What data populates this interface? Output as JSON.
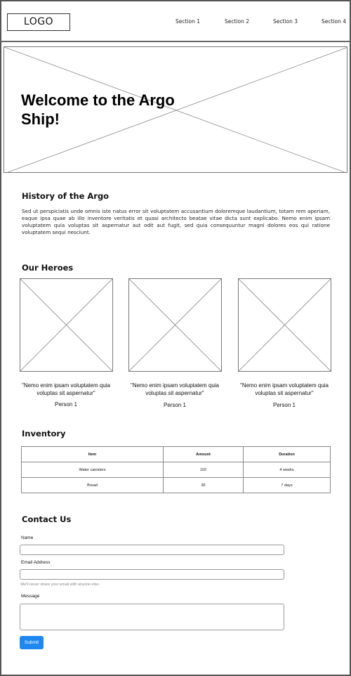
{
  "header": {
    "logo": "LOGO",
    "nav": [
      "Section 1",
      "Section 2",
      "Section 3",
      "Section 4"
    ]
  },
  "hero": {
    "title": "Welcome to the Argo Ship!"
  },
  "history": {
    "heading": "History of the Argo",
    "text": "Sed ut perspiciatis unde omnis iste natus error sit voluptatem accusantium doloremque laudantium, totam rem aperiam, eaque ipsa quae ab illo inventore veritatis et quasi architecto beatae vitae dicta sunt explicabo. Nemo enim ipsam voluptatem quia voluptas sit aspernatur aut odit aut fugit, sed quia consequuntur magni dolores eos qui ratione voluptatem sequi nesciunt."
  },
  "heroes": {
    "heading": "Our Heroes",
    "cards": [
      {
        "quote": "\"Nemo enim ipsam voluptatem quia voluptas sit aspernatur\"",
        "name": "Person 1"
      },
      {
        "quote": "\"Nemo enim ipsam voluptatem quia voluptas sit aspernatur\"",
        "name": "Person 1"
      },
      {
        "quote": "\"Nemo enim ipsam voluptatem quia voluptas sit aspernatur\"",
        "name": "Person 1"
      }
    ]
  },
  "inventory": {
    "heading": "Inventory",
    "columns": [
      "Item",
      "Amount",
      "Duration"
    ],
    "rows": [
      [
        "Water canisters",
        "102",
        "4 weeks"
      ],
      [
        "Bread",
        "30",
        "7 days"
      ]
    ]
  },
  "contact": {
    "heading": "Contact Us",
    "name_label": "Name",
    "name_value": "",
    "email_label": "Email Address",
    "email_value": "",
    "email_help": "We'll never share your email with anyone else.",
    "message_label": "Message",
    "message_value": "",
    "submit_label": "Submit"
  },
  "colors": {
    "submit_bg": "#1e88f0",
    "border": "#777777"
  }
}
